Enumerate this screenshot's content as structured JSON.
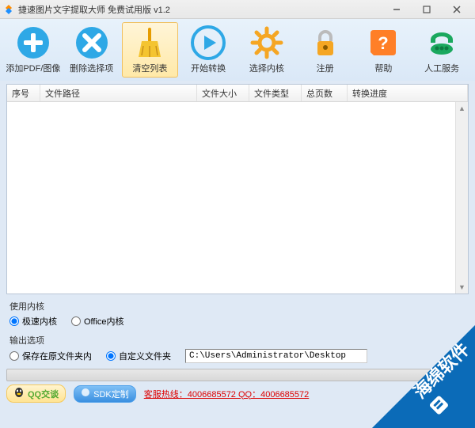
{
  "window": {
    "title": "捷速图片文字提取大师 免费试用版 v1.2"
  },
  "toolbar": {
    "items": [
      {
        "label": "添加PDF/图像"
      },
      {
        "label": "删除选择项"
      },
      {
        "label": "清空列表"
      },
      {
        "label": "开始转换"
      },
      {
        "label": "选择内核"
      },
      {
        "label": "注册"
      },
      {
        "label": "帮助"
      },
      {
        "label": "人工服务"
      }
    ]
  },
  "columns": {
    "seq": "序号",
    "path": "文件路径",
    "size": "文件大小",
    "type": "文件类型",
    "pages": "总页数",
    "progress": "转换进度"
  },
  "kernel": {
    "section_title": "使用内核",
    "opt_fast": "极速内核",
    "opt_office": "Office内核"
  },
  "output": {
    "section_title": "输出选项",
    "opt_same": "保存在原文件夹内",
    "opt_custom": "自定义文件夹",
    "path": "C:\\Users\\Administrator\\Desktop"
  },
  "bottom": {
    "qq_label": "QQ交谈",
    "sdk_label": "SDK定制",
    "hotline": "客服热线：4006685572 QQ：4006685572"
  },
  "watermark": "海绵软件"
}
